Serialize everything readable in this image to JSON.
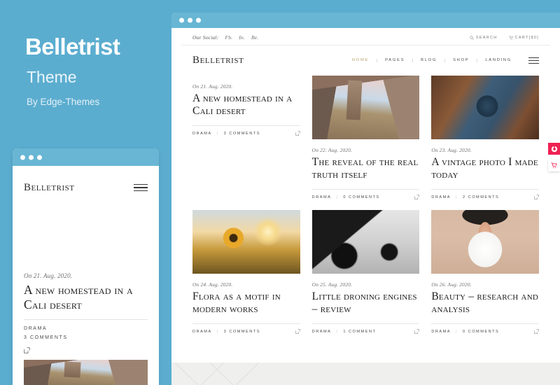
{
  "promo": {
    "title": "Belletrist",
    "subtitle": "Theme",
    "byline": "By Edge-Themes",
    "background_color": "#5badcf"
  },
  "mobile_preview": {
    "logo": "Belletrist",
    "menu_icon": "hamburger-icon",
    "post": {
      "date": "On 21. Aug. 2020.",
      "title": "A new homestead in a Cali desert",
      "category": "DRAMA",
      "comments": "3 COMMENTS",
      "share_icon": "share-icon"
    }
  },
  "browser": {
    "topbar": {
      "social_label": "Our Social:",
      "social_links": [
        "Fb.",
        "In.",
        "Be."
      ],
      "search_label": "SEARCH",
      "search_icon": "search-icon",
      "cart_label": "CART[$0]",
      "cart_icon": "cart-icon"
    },
    "header": {
      "logo": "Belletrist",
      "nav": [
        {
          "label": "HOME",
          "active": true
        },
        {
          "label": "PAGES",
          "active": false
        },
        {
          "label": "BLOG",
          "active": false
        },
        {
          "label": "SHOP",
          "active": false
        },
        {
          "label": "LANDING",
          "active": false
        }
      ],
      "menu_icon": "hamburger-icon",
      "active_color": "#b9a16b"
    },
    "posts": [
      {
        "date": "On 21. Aug. 2020.",
        "title": "A new homestead in a Cali desert",
        "category": "DRAMA",
        "comments": "3 COMMENTS",
        "image": "none",
        "share_icon": "share-icon"
      },
      {
        "date": "On 22. Aug. 2020.",
        "title": "The reveal of the real truth itself",
        "category": "DRAMA",
        "comments": "0 COMMENTS",
        "image": "church-architecture-photo",
        "share_icon": "share-icon"
      },
      {
        "date": "On 23. Aug. 2020.",
        "title": "A vintage photo I made today",
        "category": "DRAMA",
        "comments": "2 COMMENTS",
        "image": "vintage-camera-photo",
        "share_icon": "share-icon"
      },
      {
        "date": "On 24. Aug. 2020.",
        "title": "Flora as a motif in modern works",
        "category": "DRAMA",
        "comments": "3 COMMENTS",
        "image": "sunflower-sunset-photo",
        "share_icon": "share-icon"
      },
      {
        "date": "On 25. Aug. 2020.",
        "title": "Little droning engines – review",
        "category": "DRAMA",
        "comments": "1 COMMENT",
        "image": "motorcycles-bw-photo",
        "share_icon": "share-icon"
      },
      {
        "date": "On 26. Aug. 2020.",
        "title": "Beauty – research and analysis",
        "category": "DRAMA",
        "comments": "0 COMMENTS",
        "image": "woman-praying-hands-photo",
        "share_icon": "share-icon"
      }
    ],
    "side_buttons": {
      "badge_icon": "target-circle-icon",
      "badge_color": "#ef2153",
      "cart_icon": "cart-icon",
      "cart_color": "#ef2153"
    }
  }
}
